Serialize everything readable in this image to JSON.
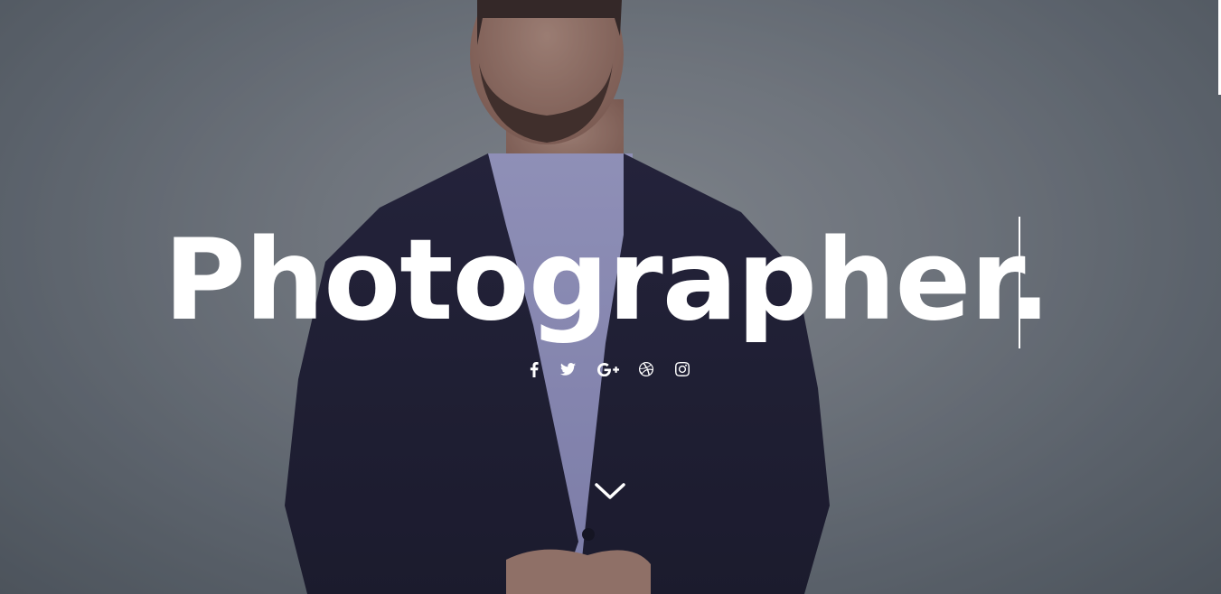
{
  "hero": {
    "headline": "Photographer."
  },
  "social_icons": [
    {
      "name": "facebook-icon"
    },
    {
      "name": "twitter-icon"
    },
    {
      "name": "google-plus-icon"
    },
    {
      "name": "dribbble-icon"
    },
    {
      "name": "instagram-icon"
    }
  ],
  "scroll_icon": "chevron-down-icon",
  "colors": {
    "headline": "#ffffff",
    "icons": "#ffffff",
    "background": "#7d838a",
    "suit": "#1c1a30"
  }
}
